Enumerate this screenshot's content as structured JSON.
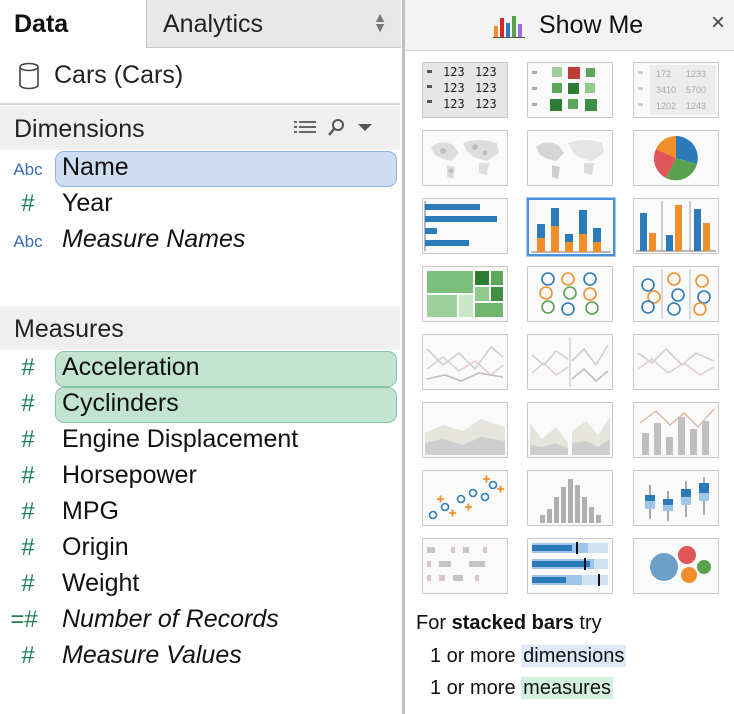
{
  "tabs": {
    "data": "Data",
    "analytics": "Analytics"
  },
  "datasource": {
    "name": "Cars (Cars)",
    "icon": "database-icon"
  },
  "dimensions": {
    "title": "Dimensions",
    "items": [
      {
        "type": "Abc",
        "name": "Name",
        "selected": true
      },
      {
        "type": "#",
        "name": "Year"
      },
      {
        "type": "Abc",
        "name": "Measure Names",
        "italic": true
      }
    ]
  },
  "measures": {
    "title": "Measures",
    "items": [
      {
        "type": "#",
        "name": "Acceleration",
        "selected": true
      },
      {
        "type": "#",
        "name": "Cyclinders",
        "selected": true
      },
      {
        "type": "#",
        "name": "Engine Displacement"
      },
      {
        "type": "#",
        "name": "Horsepower"
      },
      {
        "type": "#",
        "name": "MPG"
      },
      {
        "type": "#",
        "name": "Origin"
      },
      {
        "type": "#",
        "name": "Weight"
      },
      {
        "type": "=#",
        "name": "Number of Records",
        "italic": true
      },
      {
        "type": "#",
        "name": "Measure Values",
        "italic": true
      }
    ]
  },
  "showme": {
    "title": "Show Me",
    "close": "×",
    "chart_types": [
      "text-table",
      "heat-map",
      "highlight-table",
      "symbol-map",
      "filled-map",
      "pie-chart",
      "horizontal-bars",
      "stacked-bars",
      "side-by-side-bars",
      "treemap",
      "circle-views",
      "side-by-side-circles",
      "continuous-lines",
      "discrete-lines",
      "dual-lines",
      "area-continuous",
      "area-discrete",
      "dual-combination",
      "scatter-plot",
      "histogram",
      "box-and-whisker",
      "gantt-chart",
      "bullet-graph",
      "packed-bubbles"
    ],
    "selected_chart": "stacked-bars",
    "text_table_numbers": [
      "123",
      "123",
      "123",
      "123",
      "123",
      "123"
    ],
    "highlight_table_numbers": [
      "172",
      "1233",
      "3410",
      "5700",
      "1202",
      "1243"
    ],
    "hint": {
      "prefix": "For",
      "chart": "stacked bars",
      "suffix": "try",
      "line1_count": "1 or more",
      "line1_kind": "dimensions",
      "line2_count": "1 or more",
      "line2_kind": "measures"
    }
  },
  "colors": {
    "blue": "#2b7bba",
    "orange": "#f28e2b",
    "green_pill": "#c2e3d1",
    "blue_pill": "#cdddf4",
    "selected_border": "#4a90e2"
  }
}
